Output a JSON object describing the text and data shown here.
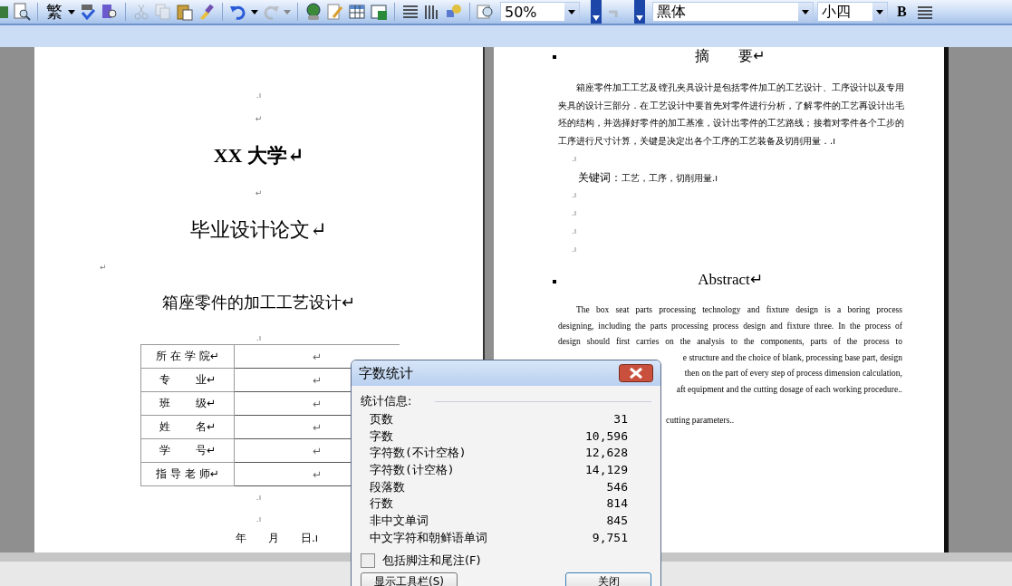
{
  "toolbar": {
    "traditional_chinese_icon": "繁",
    "zoom": "50%",
    "font": "黑体",
    "font_size": "小四",
    "bold": "B"
  },
  "left_page": {
    "paragraphs": [
      {
        "kind": "mark",
        "text": ".ı"
      },
      {
        "kind": "mark",
        "text": "↵"
      },
      {
        "kind": "title",
        "text": "XX 大学↵"
      },
      {
        "kind": "mark",
        "text": "↵"
      },
      {
        "kind": "title",
        "text": "毕业设计论文↵"
      },
      {
        "kind": "left_mark",
        "text": "↵"
      },
      {
        "kind": "subtitle",
        "text": "箱座零件的加工工艺设计↵"
      },
      {
        "kind": "mark",
        "text": ".ı"
      }
    ],
    "info_table": [
      {
        "label": "所 在 学 院↵",
        "value": "↵"
      },
      {
        "label": "专　　 业↵",
        "value": "↵"
      },
      {
        "label": "班　　 级↵",
        "value": "↵"
      },
      {
        "label": "姓　　 名↵",
        "value": "↵"
      },
      {
        "label": "学　　 号↵",
        "value": "↵"
      },
      {
        "label": "指 导 老 师↵",
        "value": "↵"
      }
    ],
    "after": [
      {
        "kind": "mark",
        "text": ".ı"
      },
      {
        "kind": "mark",
        "text": ".ı"
      },
      {
        "kind": "date",
        "text": "年　　月　　日.ı"
      }
    ]
  },
  "right_page": {
    "heading": "摘　　要↵",
    "abstract_cn": "箱座零件加工工艺及镗孔夹具设计是包括零件加工的工艺设计、工序设计以及专用夹具的设计三部分．在工艺设计中要首先对零件进行分析，了解零件的工艺再设计出毛坯的结构，并选择好零件的加工基准，设计出零件的工艺路线；接着对零件各个工步的工序进行尺寸计算，关键是决定出各个工序的工艺装备及切削用量．.ı",
    "mark": ".ı",
    "keywords": {
      "label": "关键词：",
      "text": "工艺，工序，切削用量.ı"
    },
    "marks": [
      ".ı",
      ".ı",
      ".ı",
      ".ı"
    ],
    "abstract_heading": "Abstract↵",
    "abstract_en_lines": [
      {
        "kind": "first",
        "text": "The box seat parts processing technology and fixture design is a boring process"
      },
      {
        "kind": "full",
        "text": "designing, including the parts processing process design and fixture three. In the process of"
      },
      {
        "kind": "full",
        "text": "design should first carries on the analysis to the components, parts of the process to"
      },
      {
        "kind": "tail",
        "text": "e structure and the choice of blank, processing base part, design"
      },
      {
        "kind": "tail",
        "text": "then on the part of every step of process dimension calculation,"
      },
      {
        "kind": "tail",
        "text": "aft equipment and the cutting dosage of each working procedure.."
      }
    ],
    "keywords_en_tail": "cutting parameters.."
  },
  "dialog": {
    "title": "字数统计",
    "section": "统计信息:",
    "stats": [
      {
        "label": "页数",
        "value": "31"
      },
      {
        "label": "字数",
        "value": "10,596"
      },
      {
        "label": "字符数(不计空格)",
        "value": "12,628"
      },
      {
        "label": "字符数(计空格)",
        "value": "14,129"
      },
      {
        "label": "段落数",
        "value": "546"
      },
      {
        "label": "行数",
        "value": "814"
      },
      {
        "label": "非中文单词",
        "value": "845"
      },
      {
        "label": "中文字符和朝鲜语单词",
        "value": "9,751"
      }
    ],
    "include_footnotes": {
      "label": "包括脚注和尾注(F)",
      "checked": false
    },
    "buttons": [
      "显示工具栏(S)",
      "关闭"
    ]
  }
}
